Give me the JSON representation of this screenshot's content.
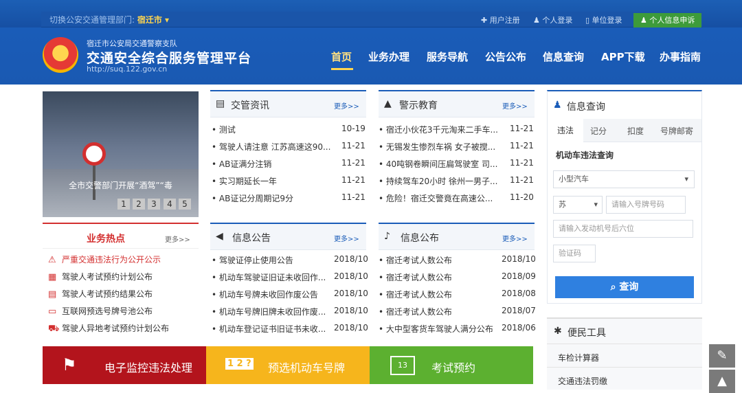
{
  "topbar": {
    "switch_label": "切换公安交通管理部门:",
    "city": "宿迁市 ▾",
    "register": "✚ 用户注册",
    "personal_login": "♟ 个人登录",
    "unit_login": "▯ 单位登录",
    "complaint": "♟ 个人信息申诉"
  },
  "header": {
    "org": "宿迁市公安局交通警察支队",
    "title": "交通安全综合服务管理平台",
    "url": "http://suq.122.gov.cn"
  },
  "nav": [
    "首页",
    "业务办理",
    "服务导航",
    "公告公布",
    "信息查询",
    "APP下载",
    "办事指南"
  ],
  "banner": {
    "caption": "全市交警部门开展“酒驾”“毒",
    "pages": [
      "1",
      "2",
      "3",
      "4",
      "5"
    ]
  },
  "news": {
    "title": "交管资讯",
    "more": "更多>>",
    "items": [
      [
        "测试",
        "10-19"
      ],
      [
        "驾驶人请注意 江苏高速这90...",
        "11-21"
      ],
      [
        "AB证满分注销",
        "11-21"
      ],
      [
        "实习期延长一年",
        "11-21"
      ],
      [
        "AB证记分周期记9分",
        "11-21"
      ]
    ]
  },
  "warn": {
    "title": "警示教育",
    "more": "更多>>",
    "items": [
      [
        "宿迁小伙花3千元淘来二手车...",
        "11-21"
      ],
      [
        "无锡发生惨烈车祸 女子被搅...",
        "11-21"
      ],
      [
        "40吨钢卷瞬间压扁驾驶室 司...",
        "11-21"
      ],
      [
        "持续驾车20小时 徐州一男子...",
        "11-21"
      ],
      [
        "危险！宿迁交警竟在高速公...",
        "11-20"
      ]
    ]
  },
  "hot": {
    "title": "业务热点",
    "more": "更多>>",
    "items": [
      "严重交通违法行为公开公示",
      "驾驶人考试预约计划公布",
      "驾驶人考试预约结果公布",
      "互联网预选号牌号池公布",
      "驾驶人异地考试预约计划公布"
    ]
  },
  "notice": {
    "title": "信息公告",
    "more": "更多>>",
    "items": [
      [
        "驾驶证停止使用公告",
        "2018/10"
      ],
      [
        "机动车驾驶证旧证未收回作...",
        "2018/10"
      ],
      [
        "机动车号牌未收回作废公告",
        "2018/10"
      ],
      [
        "机动车号牌旧牌未收回作废...",
        "2018/10"
      ],
      [
        "机动车登记证书旧证书未收...",
        "2018/10"
      ]
    ]
  },
  "publish": {
    "title": "信息公布",
    "more": "更多>>",
    "items": [
      [
        "宿迁考试人数公布",
        "2018/10"
      ],
      [
        "宿迁考试人数公布",
        "2018/09"
      ],
      [
        "宿迁考试人数公布",
        "2018/08"
      ],
      [
        "宿迁考试人数公布",
        "2018/07"
      ],
      [
        "大中型客货车驾驶人满分公布",
        "2018/06"
      ]
    ]
  },
  "buttons": {
    "b1": "电子监控违法处理",
    "b2": "预选机动车号牌",
    "b3": "考试预约"
  },
  "query": {
    "title": "信息查询",
    "tabs": [
      "违法",
      "记分",
      "扣度",
      "号牌邮寄"
    ],
    "sub": "机动车违法查询",
    "vehicle": "小型汽车",
    "prov": "苏",
    "plate_ph": "请输入号牌号码",
    "engine_ph": "请输入发动机号后六位",
    "code_ph": "验证码",
    "btn": "查询"
  },
  "tools": {
    "title": "便民工具",
    "items": [
      "车检计算器",
      "交通违法罚缴"
    ]
  },
  "colors": {
    "brand": "#1a5cb8",
    "red": "#d32f2f",
    "yellow": "#f6b51c",
    "green": "#5cb030"
  }
}
